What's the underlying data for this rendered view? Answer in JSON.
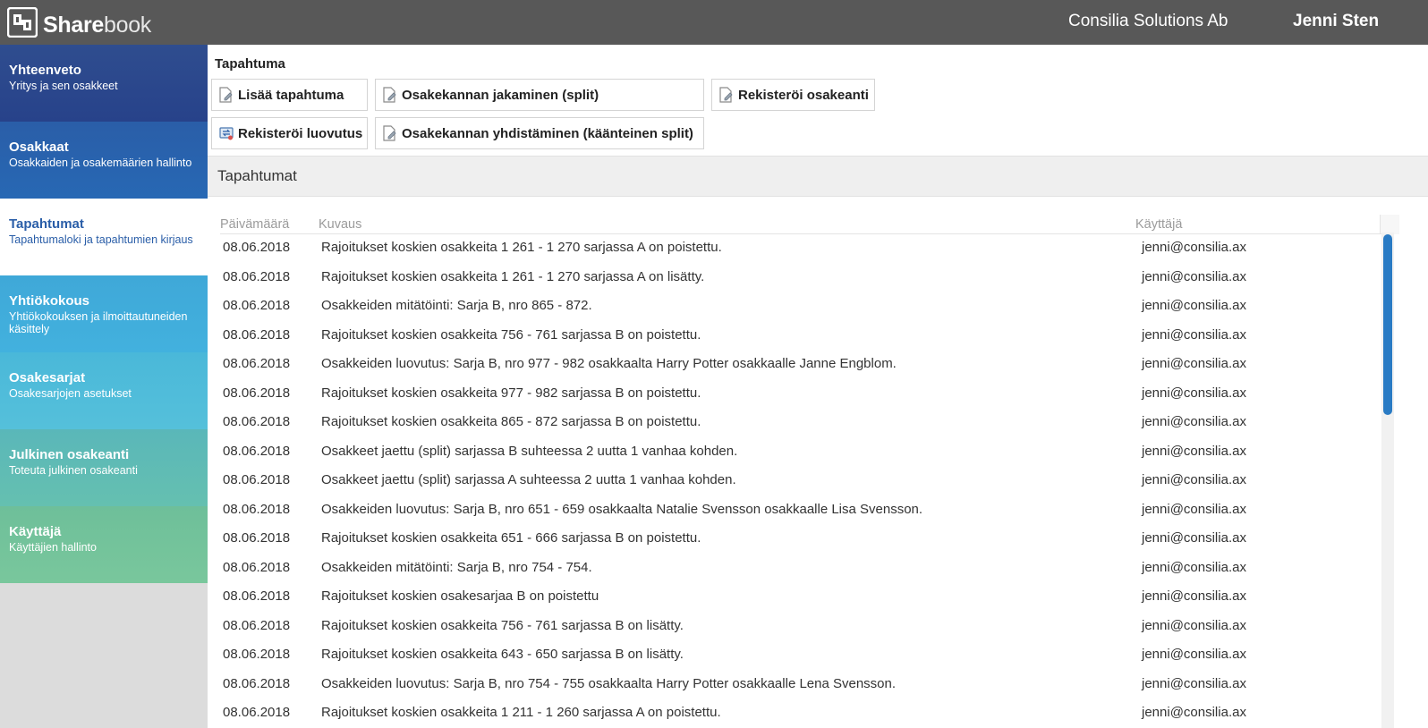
{
  "header": {
    "logo_bold": "Share",
    "logo_light": "book",
    "company": "Consilia Solutions Ab",
    "user": "Jenni Sten"
  },
  "sidebar": {
    "items": [
      {
        "title": "Yhteenveto",
        "subtitle": "Yritys ja sen osakkeet"
      },
      {
        "title": "Osakkaat",
        "subtitle": "Osakkaiden ja osakemäärien hallinto"
      },
      {
        "title": "Tapahtumat",
        "subtitle": "Tapahtumaloki ja tapahtumien kirjaus"
      },
      {
        "title": "Yhtiökokous",
        "subtitle": "Yhtiökokouksen ja ilmoittautuneiden käsittely"
      },
      {
        "title": "Osakesarjat",
        "subtitle": "Osakesarjojen asetukset"
      },
      {
        "title": "Julkinen osakeanti",
        "subtitle": "Toteuta julkinen osakeanti"
      },
      {
        "title": "Käyttäjä",
        "subtitle": "Käyttäjien hallinto"
      }
    ],
    "active_index": 2
  },
  "actions": {
    "section_label": "Tapahtuma",
    "buttons": [
      {
        "label": "Lisää tapahtuma",
        "icon": "document-edit-icon"
      },
      {
        "label": "Osakekannan jakaminen (split)",
        "icon": "document-edit-icon"
      },
      {
        "label": "Rekisteröi osakeanti",
        "icon": "document-edit-icon"
      },
      {
        "label": "Rekisteröi luovutus",
        "icon": "transfer-icon"
      },
      {
        "label": "Osakekannan yhdistäminen (käänteinen split)",
        "icon": "document-edit-icon"
      }
    ]
  },
  "events": {
    "title": "Tapahtumat",
    "columns": {
      "date": "Päivämäärä",
      "description": "Kuvaus",
      "user": "Käyttäjä"
    },
    "rows": [
      {
        "date": "08.06.2018",
        "description": "Rajoitukset koskien osakkeita 1 261 - 1 270 sarjassa A on poistettu.",
        "user": "jenni@consilia.ax"
      },
      {
        "date": "08.06.2018",
        "description": "Rajoitukset koskien osakkeita 1 261 - 1 270 sarjassa A on lisätty.",
        "user": "jenni@consilia.ax"
      },
      {
        "date": "08.06.2018",
        "description": "Osakkeiden mitätöinti: Sarja B, nro 865 - 872.",
        "user": "jenni@consilia.ax"
      },
      {
        "date": "08.06.2018",
        "description": "Rajoitukset koskien osakkeita 756 - 761 sarjassa B on poistettu.",
        "user": "jenni@consilia.ax"
      },
      {
        "date": "08.06.2018",
        "description": "Osakkeiden luovutus: Sarja B, nro 977 - 982 osakkaalta Harry Potter osakkaalle Janne Engblom.",
        "user": "jenni@consilia.ax"
      },
      {
        "date": "08.06.2018",
        "description": "Rajoitukset koskien osakkeita 977 - 982 sarjassa B on poistettu.",
        "user": "jenni@consilia.ax"
      },
      {
        "date": "08.06.2018",
        "description": "Rajoitukset koskien osakkeita 865 - 872 sarjassa B on poistettu.",
        "user": "jenni@consilia.ax"
      },
      {
        "date": "08.06.2018",
        "description": "Osakkeet jaettu (split) sarjassa B suhteessa 2 uutta 1 vanhaa kohden.",
        "user": "jenni@consilia.ax"
      },
      {
        "date": "08.06.2018",
        "description": "Osakkeet jaettu (split) sarjassa A suhteessa 2 uutta 1 vanhaa kohden.",
        "user": "jenni@consilia.ax"
      },
      {
        "date": "08.06.2018",
        "description": "Osakkeiden luovutus: Sarja B, nro 651 - 659 osakkaalta Natalie Svensson osakkaalle Lisa Svensson.",
        "user": "jenni@consilia.ax"
      },
      {
        "date": "08.06.2018",
        "description": "Rajoitukset koskien osakkeita 651 - 666 sarjassa B on poistettu.",
        "user": "jenni@consilia.ax"
      },
      {
        "date": "08.06.2018",
        "description": "Osakkeiden mitätöinti: Sarja B, nro 754 - 754.",
        "user": "jenni@consilia.ax"
      },
      {
        "date": "08.06.2018",
        "description": "Rajoitukset koskien osakesarjaa B on poistettu",
        "user": "jenni@consilia.ax"
      },
      {
        "date": "08.06.2018",
        "description": "Rajoitukset koskien osakkeita 756 - 761 sarjassa B on lisätty.",
        "user": "jenni@consilia.ax"
      },
      {
        "date": "08.06.2018",
        "description": "Rajoitukset koskien osakkeita 643 - 650 sarjassa B on lisätty.",
        "user": "jenni@consilia.ax"
      },
      {
        "date": "08.06.2018",
        "description": "Osakkeiden luovutus: Sarja B, nro 754 - 755 osakkaalta Harry Potter osakkaalle Lena Svensson.",
        "user": "jenni@consilia.ax"
      },
      {
        "date": "08.06.2018",
        "description": "Rajoitukset koskien osakkeita 1 211 - 1 260 sarjassa A on poistettu.",
        "user": "jenni@consilia.ax"
      }
    ]
  },
  "colors": {
    "topbar": "#585858",
    "accent_blue": "#2a5ea8",
    "scrollbar": "#2a7bc4"
  }
}
